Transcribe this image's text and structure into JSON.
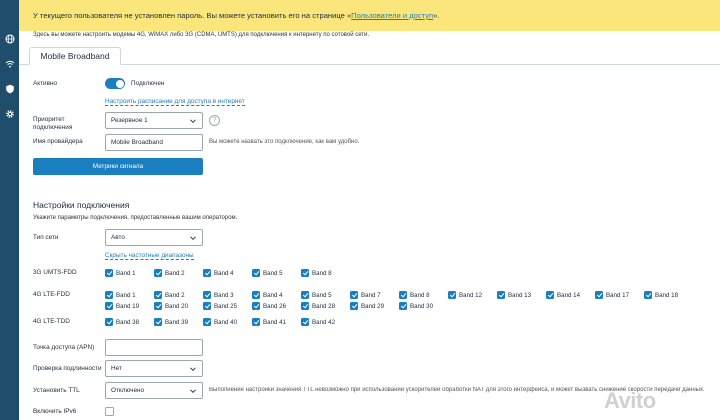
{
  "sidebar": {
    "icons": [
      "globe-icon",
      "wifi-icon",
      "shield-icon",
      "gear-icon"
    ]
  },
  "banner": {
    "text_before": "У текущего пользователя не установлен пароль. Вы можете установить его на странице «",
    "link": "Пользователи и доступ",
    "text_after": "»."
  },
  "intro": "Здесь вы можете настроить модемы 4G, WiMAX либо 3G (CDMA, UMTS) для подключения к интернету по сотовой сети.",
  "tab": {
    "label": "Mobile Broadband"
  },
  "form": {
    "active_label": "Активно",
    "active_state": "Подключен",
    "schedule_link": "Настроить расписание для доступа в интернет",
    "priority_label": "Приоритет подключения",
    "priority_value": "Резервное 1",
    "help_glyph": "?",
    "provider_label": "Имя провайдера",
    "provider_value": "Mobile Broadband",
    "provider_hint": "Вы можете назвать это подключение, как вам удобно.",
    "metrics_button": "Метрики сигнала"
  },
  "connection": {
    "title": "Настройки подключения",
    "subtitle": "Укажите параметры подключения, предоставленные вашим оператором.",
    "network_type_label": "Тип сети",
    "network_type_value": "Авто",
    "hide_link": "Скрыть частотные диапазоны",
    "umts_label": "3G UMTS-FDD",
    "umts_bands": [
      "Band 1",
      "Band 2",
      "Band 4",
      "Band 5",
      "Band 8"
    ],
    "fdd_label": "4G LTE-FDD",
    "fdd_bands_row1": [
      "Band 1",
      "Band 2",
      "Band 3",
      "Band 4",
      "Band 5",
      "Band 7",
      "Band 8",
      "Band 12",
      "Band 13",
      "Band 14",
      "Band 17",
      "Band 18"
    ],
    "fdd_bands_row2": [
      "Band 19",
      "Band 20",
      "Band 25",
      "Band 26",
      "Band 28",
      "Band 29",
      "Band 30"
    ],
    "tdd_label": "4G LTE-TDD",
    "tdd_bands": [
      "Band 38",
      "Band 39",
      "Band 40",
      "Band 41",
      "Band 42"
    ],
    "apn_label": "Точка доступа (APN)",
    "apn_value": "",
    "auth_label": "Проверка подлинности",
    "auth_value": "Нет",
    "ttl_label": "Установить TTL",
    "ttl_value": "Отключено",
    "ttl_hint": "Выполнение настройки значения TTL невозможно при использовании ускорителей обработки NAT для этого интерфейса, и может вызвать снижение скорости передачи данных.",
    "ipv6_label": "Включить IPv6"
  },
  "watermark": "Avito"
}
